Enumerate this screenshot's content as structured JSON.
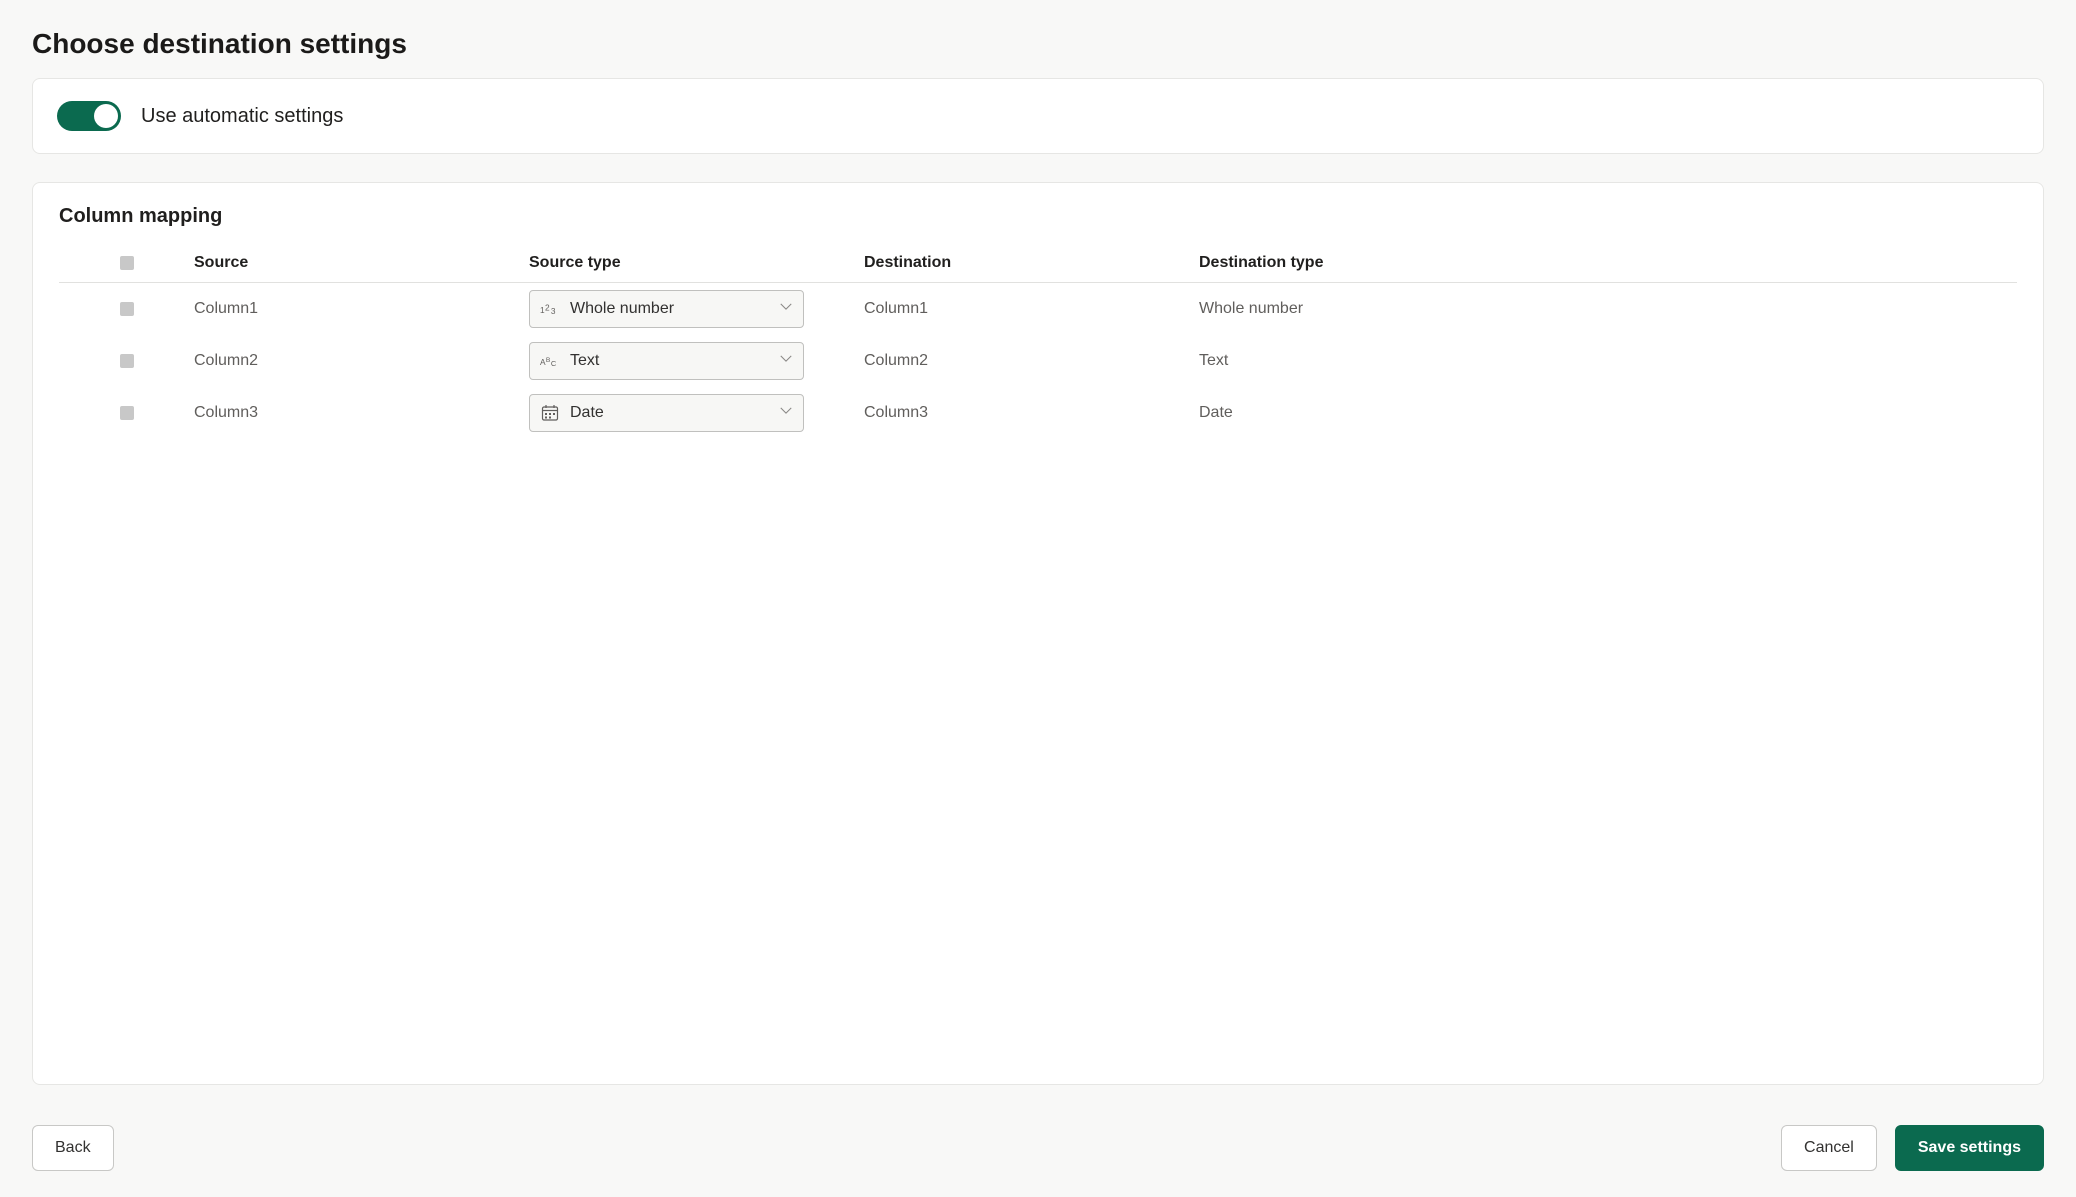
{
  "page": {
    "title": "Choose destination settings"
  },
  "settings": {
    "auto_toggle_label": "Use automatic settings",
    "auto_toggle_on": true
  },
  "mapping": {
    "section_title": "Column mapping",
    "headers": {
      "source": "Source",
      "source_type": "Source type",
      "destination": "Destination",
      "destination_type": "Destination type"
    },
    "rows": [
      {
        "source": "Column1",
        "source_type": "Whole number",
        "source_type_icon": "number-icon",
        "destination": "Column1",
        "destination_type": "Whole number"
      },
      {
        "source": "Column2",
        "source_type": "Text",
        "source_type_icon": "text-icon",
        "destination": "Column2",
        "destination_type": "Text"
      },
      {
        "source": "Column3",
        "source_type": "Date",
        "source_type_icon": "date-icon",
        "destination": "Column3",
        "destination_type": "Date"
      }
    ]
  },
  "footer": {
    "back": "Back",
    "cancel": "Cancel",
    "save": "Save settings"
  }
}
